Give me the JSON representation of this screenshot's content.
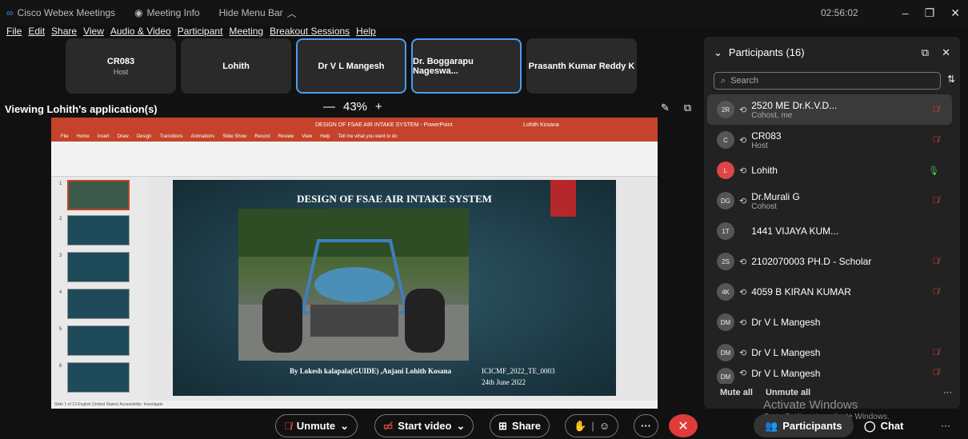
{
  "titlebar": {
    "app": "Cisco Webex Meetings",
    "meeting_info": "Meeting Info",
    "hide_menu": "Hide Menu Bar",
    "time": "02:56:02"
  },
  "menu": [
    "File",
    "Edit",
    "Share",
    "View",
    "Audio & Video",
    "Participant",
    "Meeting",
    "Breakout Sessions",
    "Help"
  ],
  "tiles": [
    {
      "name": "CR083",
      "sub": "Host",
      "active": false
    },
    {
      "name": "Lohith",
      "sub": "",
      "active": false
    },
    {
      "name": "Dr V L Mangesh",
      "sub": "",
      "active": true
    },
    {
      "name": "Dr. Boggarapu Nageswa...",
      "sub": "",
      "active": true
    },
    {
      "name": "Prasanth Kumar Reddy K",
      "sub": "",
      "active": false
    }
  ],
  "viewing": "Viewing Lohith's application(s)",
  "zoom": "43%",
  "ppt": {
    "doc_title": "DESIGN OF FSAE AIR INTAKE SYSTEM - PowerPoint",
    "user": "Lohith Kosana",
    "tabs": [
      "File",
      "Home",
      "Insert",
      "Draw",
      "Design",
      "Transitions",
      "Animations",
      "Slide Show",
      "Record",
      "Review",
      "View",
      "Help",
      "Tell me what you want to do"
    ],
    "slide_title": "DESIGN OF FSAE AIR INTAKE SYSTEM",
    "by": "By Lokesh kalapala(GUIDE) ,Anjani Lohith Kosana",
    "code": "ICICMF_2022_TE_0003",
    "date": "24th June 2022",
    "status": "Slide 1 of 13   English (United States)   Accessibility: Investigate",
    "thumbs": [
      "1",
      "2",
      "3",
      "4",
      "5",
      "6"
    ]
  },
  "participants": {
    "header": "Participants (16)",
    "search": "Search",
    "list": [
      {
        "av": "2R",
        "name": "2520 ME Dr.K.V.D...",
        "sub": "Cohost, me",
        "mic": "muted"
      },
      {
        "av": "C",
        "name": "CR083",
        "sub": "Host",
        "mic": "muted"
      },
      {
        "av": "L",
        "name": "Lohith",
        "sub": "",
        "mic": "on"
      },
      {
        "av": "DG",
        "name": "Dr.Murali G",
        "sub": "Cohost",
        "mic": "muted"
      },
      {
        "av": "1T",
        "name": "1441 VIJAYA KUM...",
        "sub": "",
        "mic": "none"
      },
      {
        "av": "2S",
        "name": "2102070003 PH.D - Scholar",
        "sub": "",
        "mic": "muted"
      },
      {
        "av": "4K",
        "name": "4059 B KIRAN KUMAR",
        "sub": "",
        "mic": "muted"
      },
      {
        "av": "DM",
        "name": "Dr V L Mangesh",
        "sub": "",
        "mic": "none"
      },
      {
        "av": "DM",
        "name": "Dr V L Mangesh",
        "sub": "",
        "mic": "muted"
      },
      {
        "av": "DM",
        "name": "Dr V L Mangesh",
        "sub": "",
        "mic": "muted"
      }
    ],
    "mute_all": "Mute all",
    "unmute_all": "Unmute all"
  },
  "watermark": {
    "line1": "Activate Windows",
    "line2": "Go to Settings to activate Windows."
  },
  "bottom": {
    "unmute": "Unmute",
    "start_video": "Start video",
    "share": "Share",
    "participants": "Participants",
    "chat": "Chat"
  }
}
